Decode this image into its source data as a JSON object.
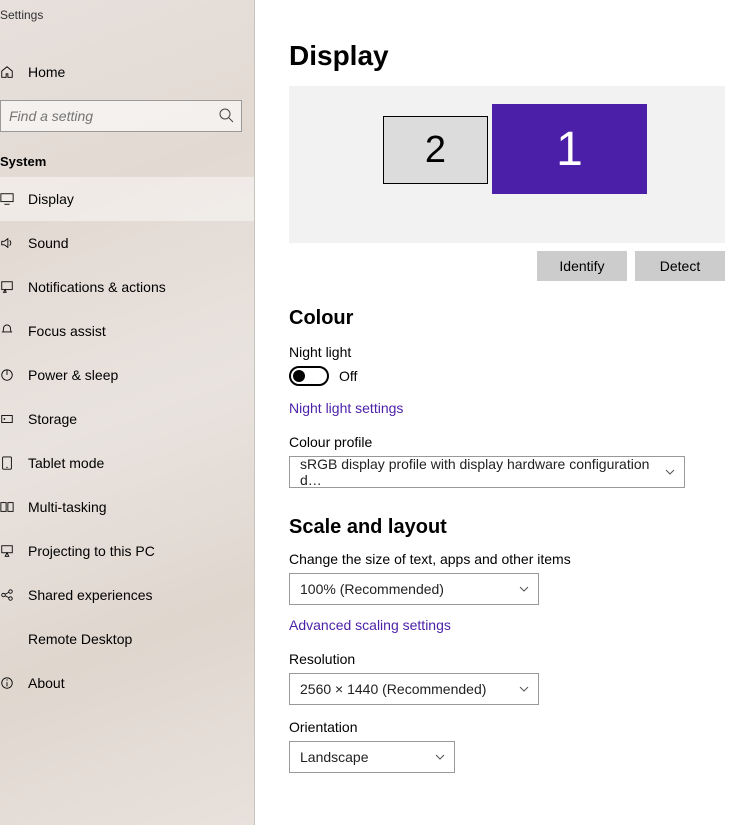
{
  "window_title": "Settings",
  "home_label": "Home",
  "search": {
    "placeholder": "Find a setting"
  },
  "category": "System",
  "nav": [
    {
      "label": "Display",
      "selected": true
    },
    {
      "label": "Sound"
    },
    {
      "label": "Notifications & actions"
    },
    {
      "label": "Focus assist"
    },
    {
      "label": "Power & sleep"
    },
    {
      "label": "Storage"
    },
    {
      "label": "Tablet mode"
    },
    {
      "label": "Multi-tasking"
    },
    {
      "label": "Projecting to this PC"
    },
    {
      "label": "Shared experiences"
    },
    {
      "label": "Remote Desktop"
    },
    {
      "label": "About"
    }
  ],
  "page": {
    "title": "Display",
    "monitors": {
      "m1": "1",
      "m2": "2"
    },
    "identify_label": "Identify",
    "detect_label": "Detect",
    "colour": {
      "heading": "Colour",
      "night_light_label": "Night light",
      "night_light_state": "Off",
      "night_light_settings_link": "Night light settings",
      "colour_profile_label": "Colour profile",
      "colour_profile_value": "sRGB display profile with display hardware configuration d…"
    },
    "scale": {
      "heading": "Scale and layout",
      "change_size_label": "Change the size of text, apps and other items",
      "size_value": "100% (Recommended)",
      "advanced_link": "Advanced scaling settings",
      "resolution_label": "Resolution",
      "resolution_value": "2560 × 1440 (Recommended)",
      "orientation_label": "Orientation",
      "orientation_value": "Landscape"
    }
  },
  "colors": {
    "accent": "#4b1fa8"
  }
}
